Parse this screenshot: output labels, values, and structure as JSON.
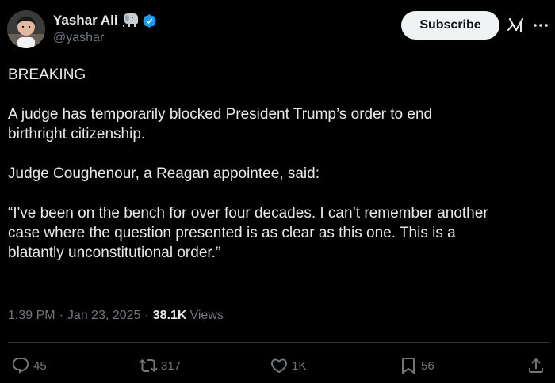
{
  "author": {
    "display_name": "Yashar Ali",
    "handle": "@yashar",
    "badge_icons": [
      "elephant-icon",
      "verified-badge-icon"
    ]
  },
  "header": {
    "subscribe_label": "Subscribe",
    "grok_icon": "grok-icon",
    "more_icon": "more-icon"
  },
  "post": {
    "paragraphs": [
      "BREAKING",
      "A judge has temporarily blocked President Trump’s order to end\nbirthright citizenship.",
      "Judge Coughenour, a Reagan appointee, said:",
      "“I've been on the bench for over four decades. I can’t remember another\ncase where the question presented is as clear as this one. This is a\nblatantly unconstitutional order.”"
    ]
  },
  "meta": {
    "time": "1:39 PM",
    "separator": "·",
    "date": "Jan 23, 2025",
    "views_count": "38.1K",
    "views_label": "Views"
  },
  "actions": {
    "reply_count": "45",
    "repost_count": "317",
    "like_count": "1K",
    "bookmark_count": "56"
  },
  "colors": {
    "background": "#000000",
    "text_primary": "#e7e9ea",
    "text_secondary": "#71767b",
    "divider": "#2f3336",
    "verified": "#1d9bf0",
    "button_bg": "#eff3f4"
  }
}
